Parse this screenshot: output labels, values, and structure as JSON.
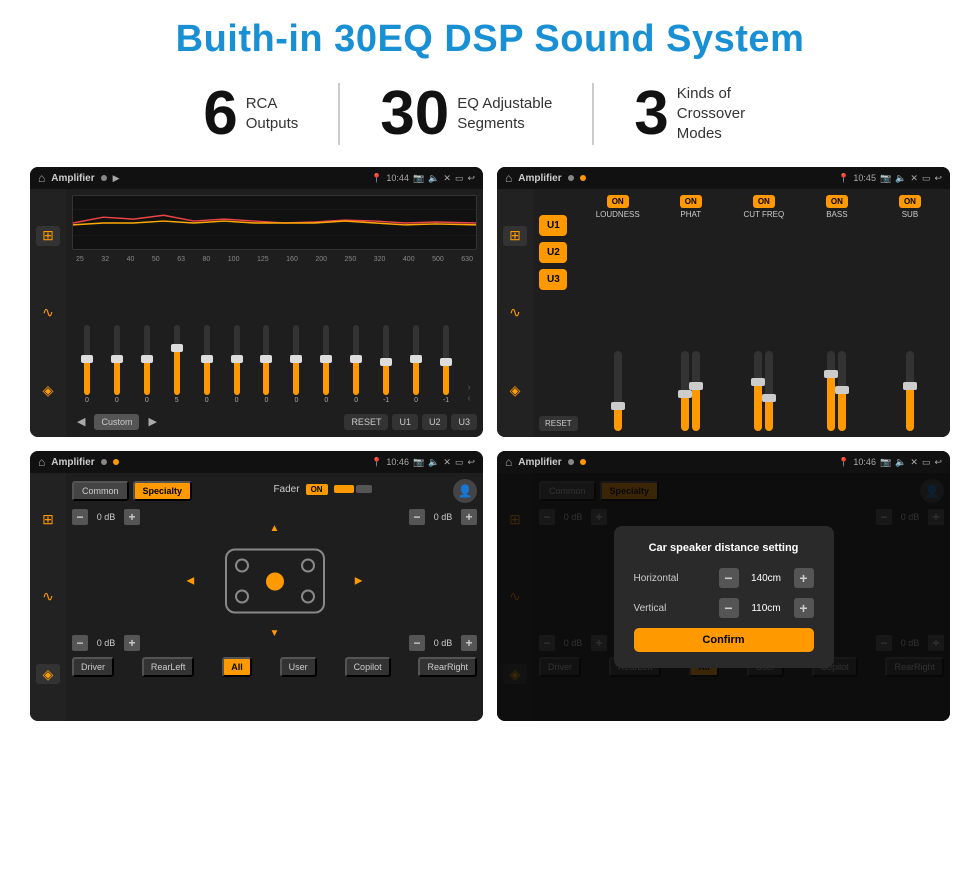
{
  "title": "Buith-in 30EQ DSP Sound System",
  "stats": [
    {
      "number": "6",
      "line1": "RCA",
      "line2": "Outputs"
    },
    {
      "number": "30",
      "line1": "EQ Adjustable",
      "line2": "Segments"
    },
    {
      "number": "3",
      "line1": "Kinds of",
      "line2": "Crossover Modes"
    }
  ],
  "screens": [
    {
      "id": "eq-screen",
      "time": "10:44",
      "app": "Amplifier",
      "freqs": [
        "25",
        "32",
        "40",
        "50",
        "63",
        "80",
        "100",
        "125",
        "160",
        "200",
        "250",
        "320",
        "400",
        "500",
        "630"
      ],
      "values": [
        "0",
        "0",
        "0",
        "5",
        "0",
        "0",
        "0",
        "0",
        "0",
        "0",
        "-1",
        "0",
        "-1"
      ],
      "buttons": [
        "Custom",
        "RESET",
        "U1",
        "U2",
        "U3"
      ]
    },
    {
      "id": "crossover-screen",
      "time": "10:45",
      "app": "Amplifier",
      "presets": [
        "U1",
        "U2",
        "U3"
      ],
      "channels": [
        "LOUDNESS",
        "PHAT",
        "CUT FREQ",
        "BASS",
        "SUB"
      ],
      "reset": "RESET"
    },
    {
      "id": "fader-screen",
      "time": "10:46",
      "app": "Amplifier",
      "modes": [
        "Common",
        "Specialty"
      ],
      "fader_label": "Fader",
      "db_rows": [
        [
          "— 0 dB +",
          "— 0 dB +"
        ],
        [
          "— 0 dB +",
          "— 0 dB +"
        ]
      ],
      "bottom_btns": [
        "Driver",
        "RearLeft",
        "All",
        "User",
        "Copilot",
        "RearRight"
      ]
    },
    {
      "id": "dialog-screen",
      "time": "10:46",
      "app": "Amplifier",
      "dialog": {
        "title": "Car speaker distance setting",
        "rows": [
          {
            "label": "Horizontal",
            "value": "140cm"
          },
          {
            "label": "Vertical",
            "value": "110cm"
          }
        ],
        "confirm": "Confirm"
      }
    }
  ],
  "icons": {
    "home": "⌂",
    "eq": "≡",
    "wave": "∿",
    "speaker": "◈",
    "arrow_left": "◀",
    "arrow_right": "▶",
    "arrow_up": "▲",
    "arrow_down": "▼",
    "chevron_up": "›",
    "chevron_down": "‹",
    "play": "▶",
    "back": "↩"
  }
}
